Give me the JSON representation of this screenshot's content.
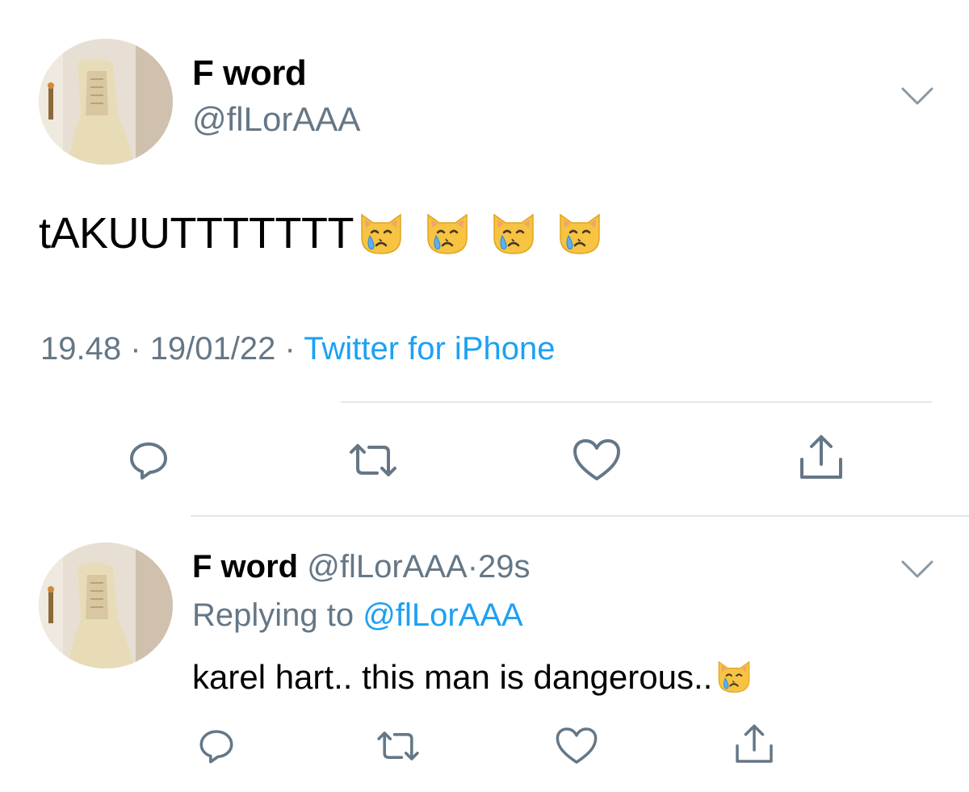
{
  "main_tweet": {
    "display_name": "F word",
    "handle": "@flLorAAA",
    "text": "tAKUUTTTTTTT",
    "emoji_count": 4,
    "emoji_icon": "crying-cat-face-icon",
    "time": "19.48",
    "separator": "·",
    "date": "19/01/22",
    "source": "Twitter for iPhone",
    "actions": [
      "reply-icon",
      "retweet-icon",
      "like-icon",
      "share-icon"
    ]
  },
  "reply_tweet": {
    "display_name": "F word",
    "handle": "@flLorAAA",
    "separator": "·",
    "age": "29s",
    "replying_prefix": "Replying to",
    "replying_handle": "@flLorAAA",
    "text": "karel hart.. this man is dangerous..",
    "emoji_count": 1,
    "emoji_icon": "crying-cat-face-icon",
    "actions": [
      "reply-icon",
      "retweet-icon",
      "like-icon",
      "share-icon"
    ]
  },
  "colors": {
    "primary_text": "#000000",
    "secondary_text": "#657786",
    "link": "#1da1f2",
    "divider": "#e1e8ed",
    "icon": "#657786"
  }
}
